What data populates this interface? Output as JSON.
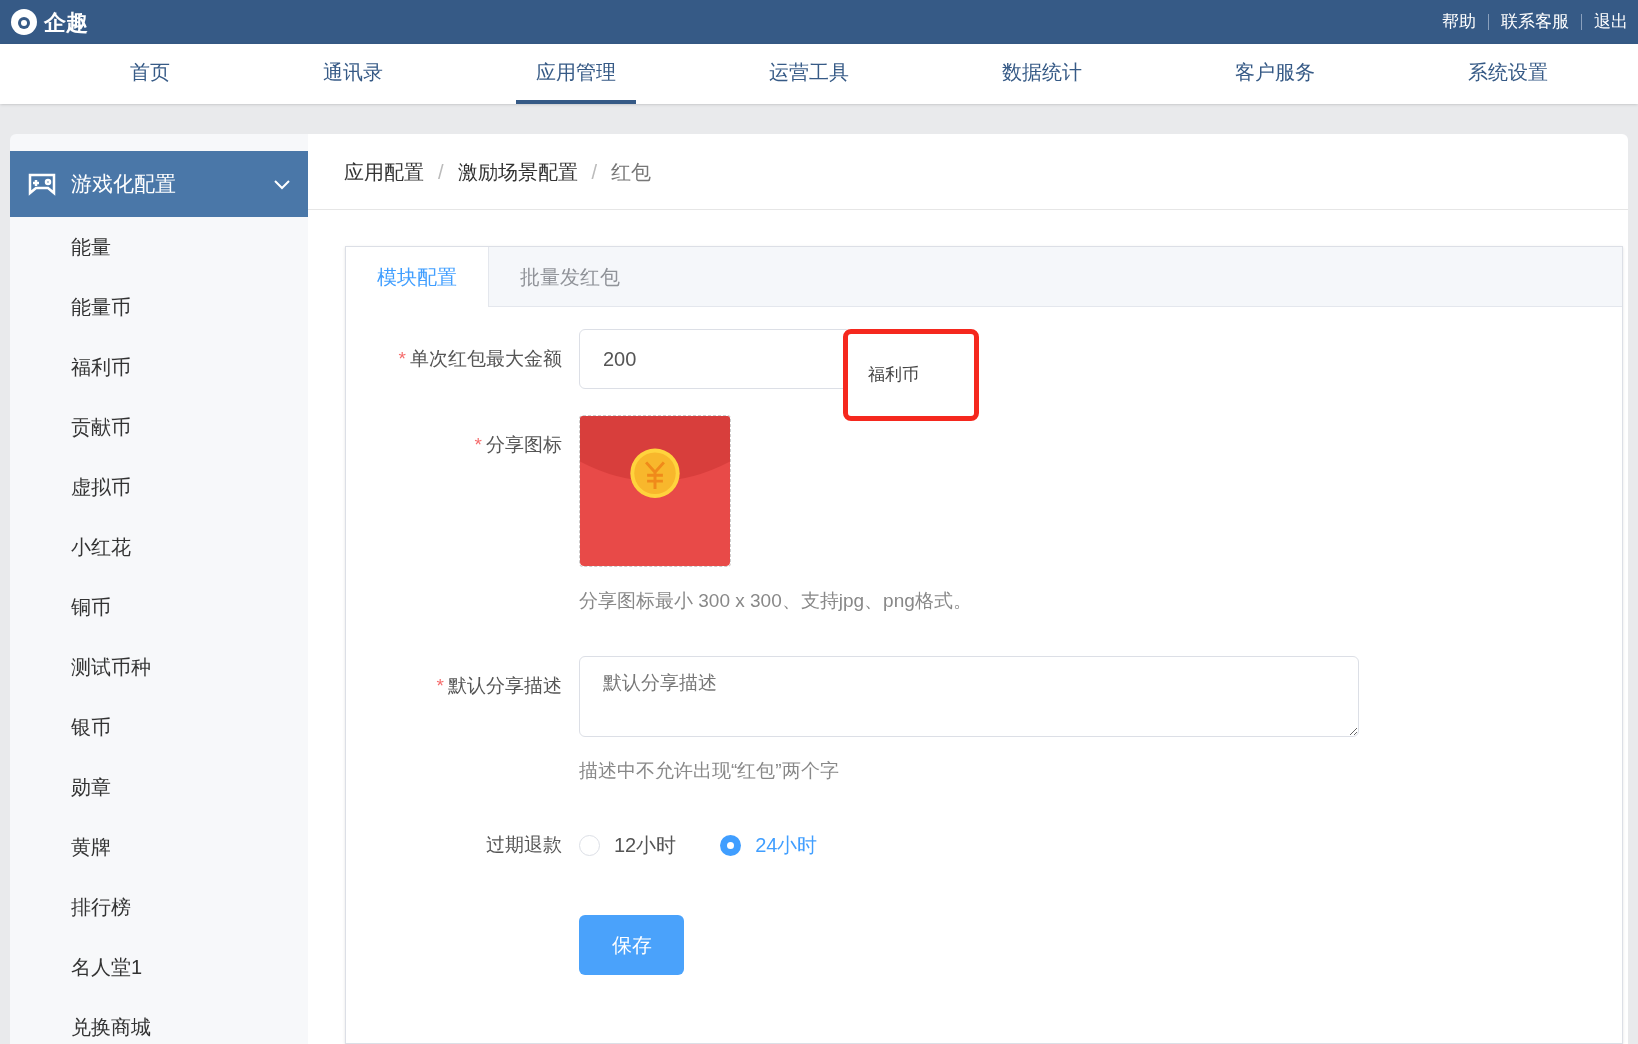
{
  "brand": {
    "name": "企趣"
  },
  "header_links": [
    "帮助",
    "联系客服",
    "退出"
  ],
  "nav": [
    {
      "label": "首页",
      "selected": false
    },
    {
      "label": "通讯录",
      "selected": false
    },
    {
      "label": "应用管理",
      "selected": true
    },
    {
      "label": "运营工具",
      "selected": false
    },
    {
      "label": "数据统计",
      "selected": false
    },
    {
      "label": "客户服务",
      "selected": false
    },
    {
      "label": "系统设置",
      "selected": false
    }
  ],
  "sidebar": {
    "group": {
      "label": "游戏化配置",
      "expanded": true
    },
    "items": [
      "能量",
      "能量币",
      "福利币",
      "贡献币",
      "虚拟币",
      "小红花",
      "铜币",
      "测试币种",
      "银币",
      "勋章",
      "黄牌",
      "排行榜",
      "名人堂1",
      "兑换商城"
    ]
  },
  "breadcrumb": {
    "items": [
      "应用配置",
      "激励场景配置",
      "红包"
    ],
    "separator": "/"
  },
  "required_mark": "*",
  "tabs": [
    {
      "label": "模块配置",
      "selected": true
    },
    {
      "label": "批量发红包",
      "selected": false
    }
  ],
  "form": {
    "max_amount": {
      "label": "单次红包最大金额",
      "required": true,
      "value": "200",
      "suffix": "福利币",
      "highlighted": true
    },
    "share_icon": {
      "label": "分享图标",
      "required": true,
      "hint": "分享图标最小 300 x 300、支持jpg、png格式。"
    },
    "share_desc": {
      "label": "默认分享描述",
      "required": true,
      "placeholder": "默认分享描述",
      "hint": "描述中不允许出现“红包”两个字"
    },
    "refund": {
      "label": "过期退款",
      "required": false,
      "options": [
        {
          "label": "12小时",
          "selected": false
        },
        {
          "label": "24小时",
          "selected": true
        }
      ]
    },
    "save": "保存"
  }
}
